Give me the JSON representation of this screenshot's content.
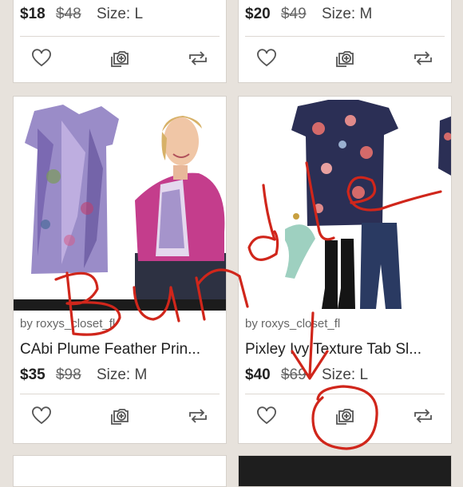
{
  "listings": [
    {
      "price": "$18",
      "original_price": "$48",
      "size": "Size: L"
    },
    {
      "price": "$20",
      "original_price": "$49",
      "size": "Size: M"
    },
    {
      "seller": "by roxys_closet_fl",
      "title": "CAbi Plume Feather Prin...",
      "price": "$35",
      "original_price": "$98",
      "size": "Size: M"
    },
    {
      "seller": "by roxys_closet_fl",
      "title": "Pixley Ivy Texture Tab Sl...",
      "price": "$40",
      "original_price": "$69",
      "size": "Size: L"
    }
  ],
  "icons": {
    "like": "heart-icon",
    "bundle": "add-to-bundle-icon",
    "share": "share-icon"
  },
  "colors": {
    "background": "#e7e2dc",
    "annotation": "#d0261b",
    "icon_stroke": "#555555"
  },
  "annotation": {
    "text": "Bundle"
  }
}
